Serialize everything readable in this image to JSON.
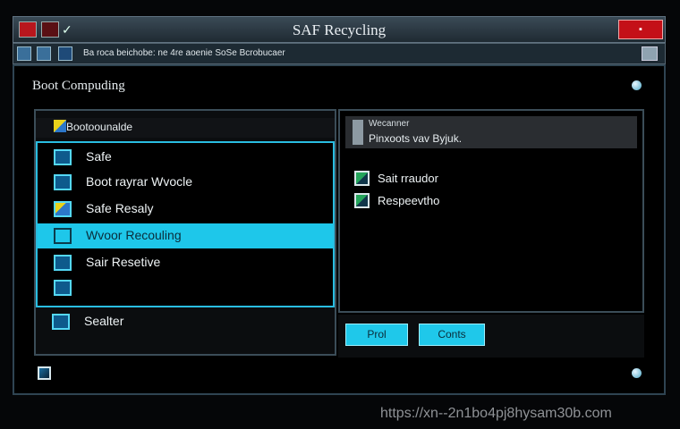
{
  "window": {
    "title": "SAF Recycling",
    "toolbar_text": "Ba roca beichobe: ne 4re aoenie SoSe Bcrobucaer"
  },
  "main": {
    "title": "Boot Compuding"
  },
  "left_panel": {
    "header": "Bootoounalde",
    "items": [
      {
        "label": "Safe",
        "selected": false
      },
      {
        "label": "Boot rayrar Wvocle",
        "selected": false
      },
      {
        "label": "Safe Resaly",
        "selected": false
      },
      {
        "label": "Wvoor Recouling",
        "selected": true
      },
      {
        "label": "Sair Resetive",
        "selected": false
      },
      {
        "label": "",
        "selected": false
      }
    ],
    "bottom_item": "Sealter"
  },
  "right_panel": {
    "header_line1": "Wecanner",
    "header_line2": "Pinxoots vav Byjuk.",
    "items": [
      {
        "label": "Sait rraudor"
      },
      {
        "label": "Respeevtho"
      }
    ]
  },
  "buttons": {
    "prev": "Prol",
    "cont": "Conts"
  },
  "watermark": "https://xn--2n1bo4pj8hysam30b.com",
  "colors": {
    "accent": "#1ec7ea",
    "close": "#c41018"
  },
  "icons": {
    "close": "close-icon",
    "row": "folder-icon",
    "check": "check-icon"
  }
}
